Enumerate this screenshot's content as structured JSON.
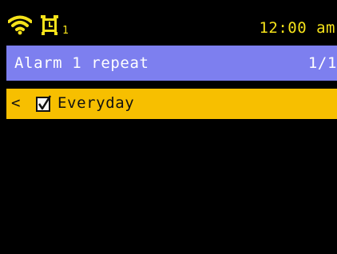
{
  "status_bar": {
    "wifi_icon": "wifi-icon",
    "alarm_icon": "alarm-clock-icon",
    "alarm_index": "1",
    "time": "12:00 am"
  },
  "header": {
    "title": "Alarm 1 repeat",
    "page": "1/1"
  },
  "menu": {
    "items": [
      {
        "back_glyph": "<",
        "checked": true,
        "label": "Everyday",
        "selected": true
      }
    ]
  },
  "colors": {
    "background": "#000000",
    "status_yellow": "#f5e21a",
    "title_bar": "#7d7fef",
    "selected_row": "#f7bf00"
  }
}
